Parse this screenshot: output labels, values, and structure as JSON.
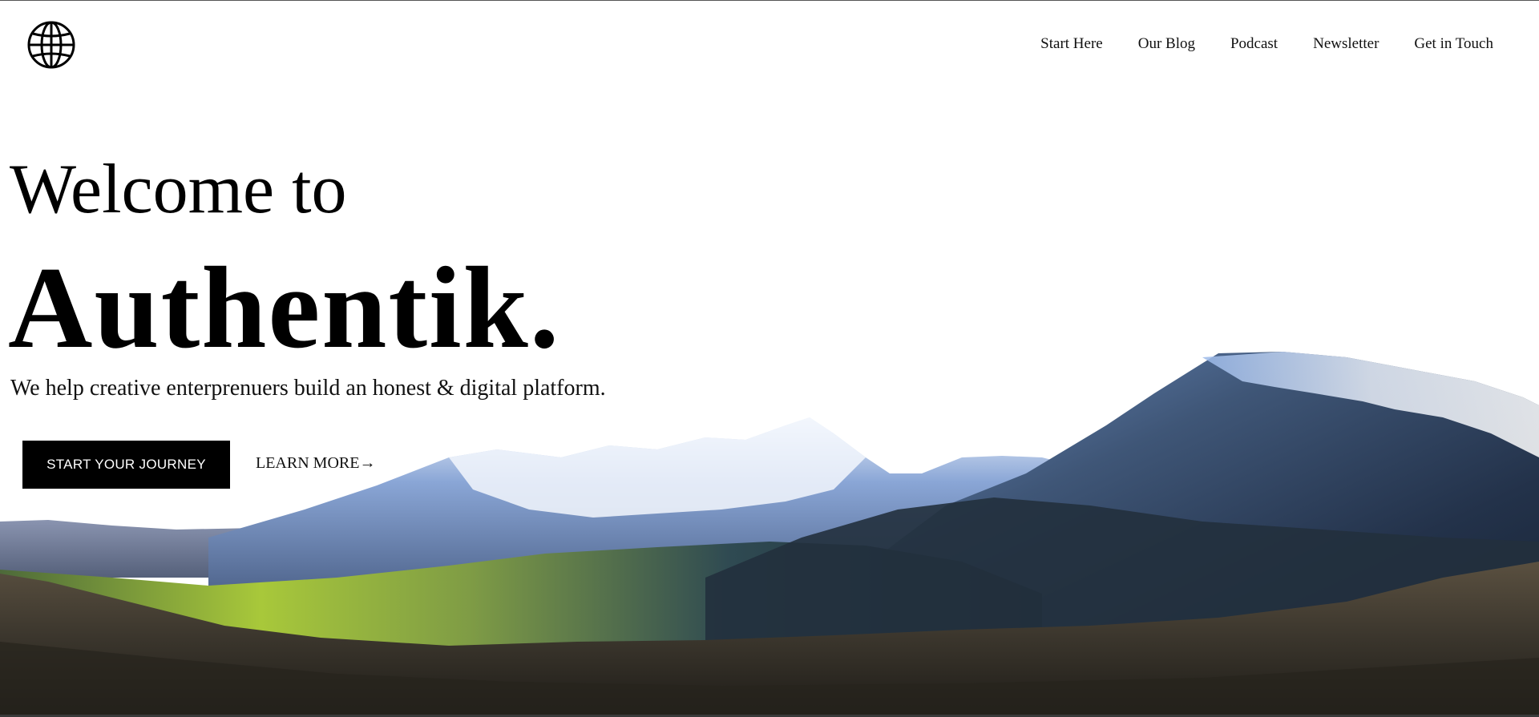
{
  "header": {
    "logo_icon": "globe-icon",
    "nav": [
      {
        "label": "Start Here"
      },
      {
        "label": "Our Blog"
      },
      {
        "label": "Podcast"
      },
      {
        "label": "Newsletter"
      },
      {
        "label": "Get in Touch"
      }
    ]
  },
  "hero": {
    "welcome": "Welcome to",
    "brand": "Authentik.",
    "tagline": "We help creative enterprenuers build an honest & digital platform.",
    "primary_cta": "START YOUR JOURNEY",
    "secondary_cta": "LEARN MORE→"
  },
  "colors": {
    "background": "#ffffff",
    "text": "#000000",
    "button_bg": "#000000",
    "button_text": "#ffffff"
  }
}
